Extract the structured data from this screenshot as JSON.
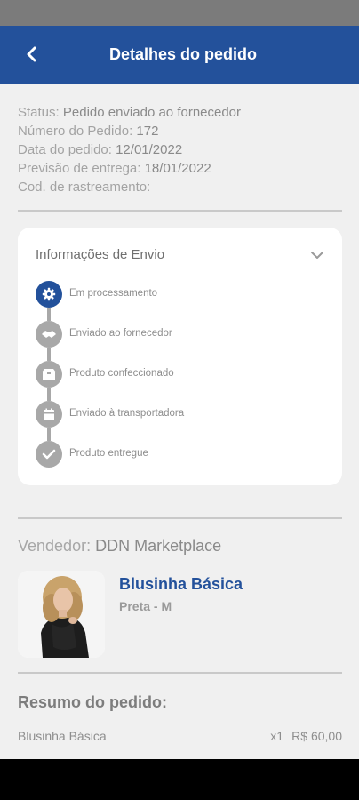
{
  "header": {
    "title": "Detalhes do pedido"
  },
  "order_info": [
    {
      "label": "Status:",
      "value": "Pedido enviado ao fornecedor"
    },
    {
      "label": "Número do Pedido:",
      "value": "172"
    },
    {
      "label": "Data do pedido:",
      "value": "12/01/2022"
    },
    {
      "label": "Previsão de entrega:",
      "value": "18/01/2022"
    },
    {
      "label": "Cod. de rastreamento:",
      "value": ""
    }
  ],
  "shipping": {
    "title": "Informações de Envio",
    "steps": [
      {
        "label": "Em processamento",
        "icon": "gear-icon",
        "active": true
      },
      {
        "label": "Enviado ao fornecedor",
        "icon": "handshake-icon",
        "active": false
      },
      {
        "label": "Produto confeccionado",
        "icon": "box-icon",
        "active": false
      },
      {
        "label": "Enviado à transportadora",
        "icon": "calendar-icon",
        "active": false
      },
      {
        "label": "Produto entregue",
        "icon": "check-icon",
        "active": false
      }
    ]
  },
  "vendor": {
    "label": "Vendedor:",
    "name": "DDN Marketplace"
  },
  "product": {
    "name": "Blusinha Básica",
    "variant": "Preta - M"
  },
  "summary": {
    "title": "Resumo do pedido:",
    "items": [
      {
        "name": "Blusinha Básica",
        "qty": "x1",
        "price": "R$ 60,00"
      }
    ]
  },
  "colors": {
    "primary": "#23519b",
    "background": "#f0f0f0",
    "inactive_step": "#a8a8a8"
  }
}
